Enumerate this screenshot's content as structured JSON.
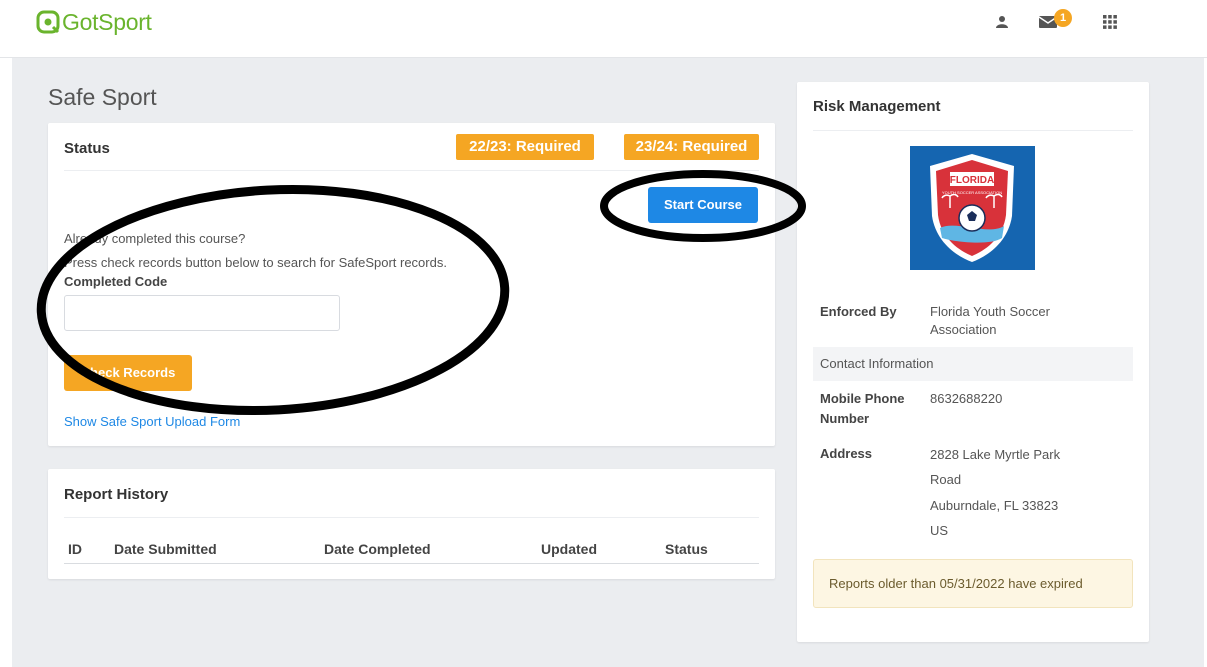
{
  "brand": {
    "logo_text": "GotSport",
    "color": "#6ab42d"
  },
  "navbar": {
    "icons": [
      "user-icon",
      "mail-icon",
      "apps-grid-icon"
    ],
    "mail_badge": "1"
  },
  "page": {
    "title": "Safe Sport"
  },
  "status_card": {
    "title": "Status",
    "badges": [
      "22/23: Required",
      "23/24: Required"
    ],
    "start_button": "Start Course",
    "already_text": "Already completed this course?",
    "press_text": "Press check records button below to search for SafeSport records.",
    "code_label": "Completed Code",
    "code_value": "",
    "check_button": "Check Records",
    "upload_link": "Show Safe Sport Upload Form"
  },
  "report_history": {
    "title": "Report History",
    "columns": [
      "ID",
      "Date Submitted",
      "Date Completed",
      "Updated",
      "Status"
    ]
  },
  "risk_management": {
    "title": "Risk Management",
    "logo_text": "FLORIDA",
    "logo_subtext": "YOUTH SOCCER ASSOCIATION",
    "enforced_by_label": "Enforced By",
    "enforced_by_value": [
      "Florida Youth Soccer",
      "Association"
    ],
    "contact_header": "Contact Information",
    "phone_label": [
      "Mobile Phone",
      "Number"
    ],
    "phone_value": "8632688220",
    "address_label": "Address",
    "address_value": [
      "2828 Lake Myrtle Park",
      "Road",
      "Auburndale, FL 33823",
      "US"
    ],
    "expired_notice": "Reports older than 05/31/2022 have expired"
  },
  "colors": {
    "accent_orange": "#f5a623",
    "primary_blue": "#1e88e5",
    "background_grey": "#ebedf0"
  }
}
